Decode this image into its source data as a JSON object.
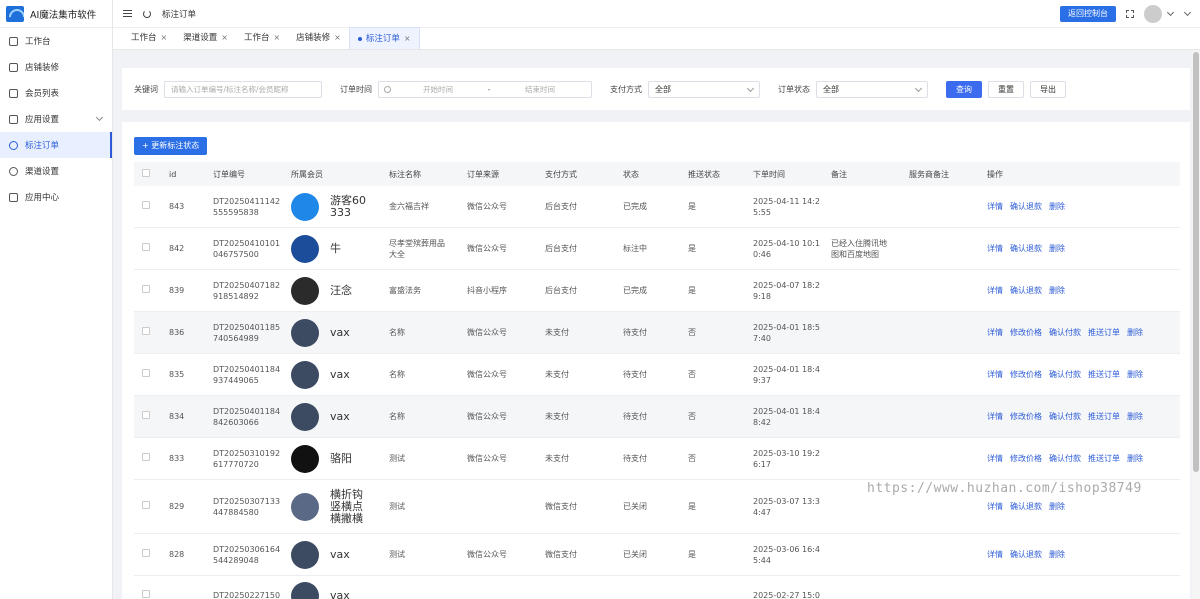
{
  "app": {
    "title": "AI魔法集市软件"
  },
  "sidebar": {
    "items": [
      {
        "label": "工作台",
        "icon": "monitor-icon",
        "active": false
      },
      {
        "label": "店铺装修",
        "icon": "shop-icon",
        "active": false
      },
      {
        "label": "会员列表",
        "icon": "user-icon",
        "active": false
      },
      {
        "label": "应用设置",
        "icon": "gear-icon",
        "active": false,
        "expandable": true
      },
      {
        "label": "标注订单",
        "icon": "location-icon",
        "active": true
      },
      {
        "label": "渠道设置",
        "icon": "clock-icon",
        "active": false
      },
      {
        "label": "应用中心",
        "icon": "grid-icon",
        "active": false
      }
    ]
  },
  "header": {
    "breadcrumb": "标注订单",
    "console_button": "返回控制台"
  },
  "tabs": [
    {
      "label": "工作台",
      "active": false
    },
    {
      "label": "渠道设置",
      "active": false
    },
    {
      "label": "工作台",
      "active": false
    },
    {
      "label": "店铺装修",
      "active": false
    },
    {
      "label": "标注订单",
      "active": true
    }
  ],
  "filter": {
    "keyword_label": "关键词",
    "keyword_placeholder": "请输入订单编号/标注名称/会员昵称",
    "time_label": "订单时间",
    "start_placeholder": "开始时间",
    "date_sep": "-",
    "end_placeholder": "结束时间",
    "pay_label": "支付方式",
    "pay_value": "全部",
    "status_label": "订单状态",
    "status_value": "全部",
    "query_button": "查询",
    "reset_button": "重置",
    "export_button": "导出"
  },
  "table": {
    "add_button": "+ 更新标注状态",
    "columns": [
      "id",
      "订单编号",
      "所属会员",
      "标注名称",
      "订单来源",
      "支付方式",
      "状态",
      "推送状态",
      "下单时间",
      "备注",
      "服务商备注",
      "操作"
    ],
    "rows": [
      {
        "id": "843",
        "no": [
          "DT20250411142",
          "555595838"
        ],
        "member": [
          "游客60",
          "333"
        ],
        "avatar": "#1f87e8",
        "name": [
          "金六福吉祥"
        ],
        "source": "微信公众号",
        "pay": "后台支付",
        "status": "已完成",
        "push": "是",
        "time": [
          "2025-04-11 14:2",
          "5:55"
        ],
        "remark": [],
        "ops": [
          "详情",
          "确认退款",
          "删除"
        ]
      },
      {
        "id": "842",
        "no": [
          "DT20250410101",
          "046757500"
        ],
        "member": [
          "牛"
        ],
        "avatar": "#1b4d9a",
        "name": [
          "尽孝堂殡葬用品",
          "大全"
        ],
        "source": "微信公众号",
        "pay": "后台支付",
        "status": "标注中",
        "push": "是",
        "time": [
          "2025-04-10 10:1",
          "0:46"
        ],
        "remark": [
          "已经入住腾讯地",
          "图和百度地图"
        ],
        "ops": [
          "详情",
          "确认退款",
          "删除"
        ]
      },
      {
        "id": "839",
        "no": [
          "DT20250407182",
          "918514892"
        ],
        "member": [
          "汪念"
        ],
        "avatar": "#2b2b2b",
        "name": [
          "富盛法务"
        ],
        "source": "抖音小程序",
        "pay": "后台支付",
        "status": "已完成",
        "push": "是",
        "time": [
          "2025-04-07 18:2",
          "9:18"
        ],
        "remark": [],
        "ops": [
          "详情",
          "确认退款",
          "删除"
        ]
      },
      {
        "id": "836",
        "no": [
          "DT20250401185",
          "740564989"
        ],
        "member": [
          "vax"
        ],
        "avatar": "#3c4b62",
        "name": [
          "名称"
        ],
        "source": "微信公众号",
        "pay": "未支付",
        "status": "待支付",
        "push": "否",
        "time": [
          "2025-04-01 18:5",
          "7:40"
        ],
        "remark": [],
        "ops": [
          "详情",
          "修改价格",
          "确认付款",
          "推送订单",
          "删除"
        ]
      },
      {
        "id": "835",
        "no": [
          "DT20250401184",
          "937449065"
        ],
        "member": [
          "vax"
        ],
        "avatar": "#3c4b62",
        "name": [
          "名称"
        ],
        "source": "微信公众号",
        "pay": "未支付",
        "status": "待支付",
        "push": "否",
        "time": [
          "2025-04-01 18:4",
          "9:37"
        ],
        "remark": [],
        "ops": [
          "详情",
          "修改价格",
          "确认付款",
          "推送订单",
          "删除"
        ]
      },
      {
        "id": "834",
        "no": [
          "DT20250401184",
          "842603066"
        ],
        "member": [
          "vax"
        ],
        "avatar": "#3c4b62",
        "name": [
          "名称"
        ],
        "source": "微信公众号",
        "pay": "未支付",
        "status": "待支付",
        "push": "否",
        "time": [
          "2025-04-01 18:4",
          "8:42"
        ],
        "remark": [],
        "ops": [
          "详情",
          "修改价格",
          "确认付款",
          "推送订单",
          "删除"
        ]
      },
      {
        "id": "833",
        "no": [
          "DT20250310192",
          "617770720"
        ],
        "member": [
          "骆阳"
        ],
        "avatar": "#111111",
        "name": [
          "测试"
        ],
        "source": "微信公众号",
        "pay": "未支付",
        "status": "待支付",
        "push": "否",
        "time": [
          "2025-03-10 19:2",
          "6:17"
        ],
        "remark": [],
        "ops": [
          "详情",
          "修改价格",
          "确认付款",
          "推送订单",
          "删除"
        ]
      },
      {
        "id": "829",
        "no": [
          "DT20250307133",
          "447884580"
        ],
        "member": [
          "横折钩",
          "竖横点",
          "横撇横"
        ],
        "avatar": "#5a6a86",
        "name": [
          "测试"
        ],
        "source": "",
        "pay": "微信支付",
        "status": "已关闭",
        "push": "是",
        "time": [
          "2025-03-07 13:3",
          "4:47"
        ],
        "remark": [],
        "ops": [
          "详情",
          "确认退款",
          "删除"
        ]
      },
      {
        "id": "828",
        "no": [
          "DT20250306164",
          "544289048"
        ],
        "member": [
          "vax"
        ],
        "avatar": "#3c4b62",
        "name": [
          "测试"
        ],
        "source": "微信公众号",
        "pay": "微信支付",
        "status": "已关闭",
        "push": "是",
        "time": [
          "2025-03-06 16:4",
          "5:44"
        ],
        "remark": [],
        "ops": [
          "详情",
          "确认退款",
          "删除"
        ]
      },
      {
        "id": "",
        "no": [
          "DT20250227150",
          ""
        ],
        "member": [
          "vax"
        ],
        "avatar": "#3c4b62",
        "name": [],
        "source": "",
        "pay": "",
        "status": "",
        "push": "",
        "time": [
          "2025-02-27 15:0",
          ""
        ],
        "remark": [],
        "ops": []
      }
    ]
  },
  "watermark": "https://www.huzhan.com/ishop38749"
}
